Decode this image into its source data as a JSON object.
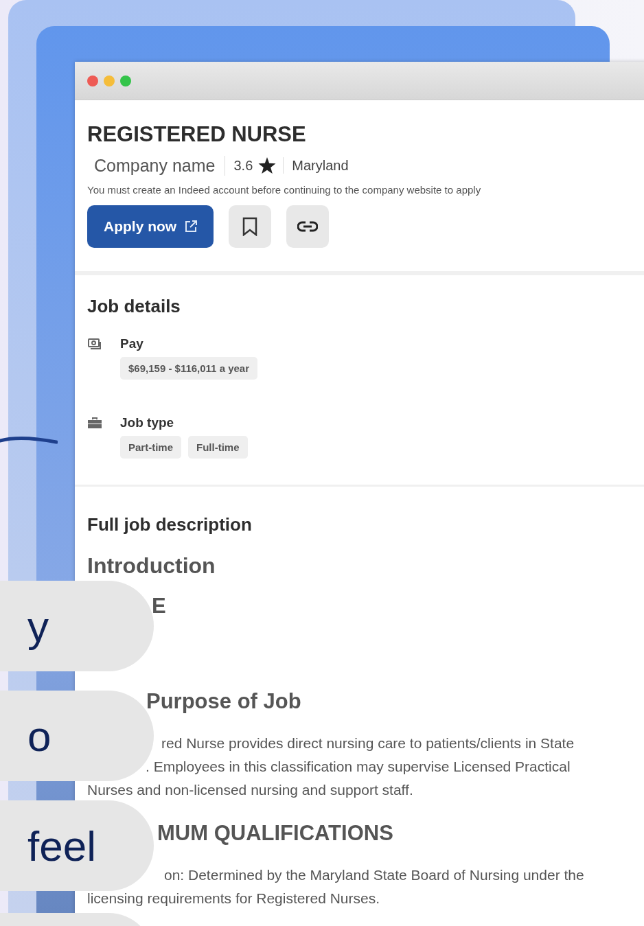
{
  "window": {
    "controls": [
      {
        "color": "#ee5b55"
      },
      {
        "color": "#f5bd3a"
      },
      {
        "color": "#34c44a"
      }
    ]
  },
  "job": {
    "title": "REGISTERED NURSE",
    "company": "Company name",
    "rating": "3.6",
    "location": "Maryland",
    "notice": "You must create an Indeed account before continuing to the company website to apply",
    "apply_button": "Apply now"
  },
  "job_details": {
    "heading": "Job details",
    "items": [
      {
        "kind": "pay",
        "label": "Pay",
        "tags": [
          "$69,159 - $116,011 a year"
        ]
      },
      {
        "kind": "job_type",
        "label": "Job type",
        "tags": [
          "Part-time",
          "Full-time"
        ]
      }
    ]
  },
  "description": {
    "heading": "Full job description",
    "blocks": [
      {
        "kind": "heading",
        "lines": [
          "Introduction"
        ]
      },
      {
        "kind": "subheading",
        "lines": [
          "E"
        ]
      },
      {
        "kind": "subheading",
        "lines": [
          "Purpose of Job"
        ]
      },
      {
        "kind": "paragraph",
        "lines": [
          "red Nurse provides direct nursing care to patients/clients in State",
          ". Employees in this classification may supervise Licensed Practical",
          "Nurses and non-licensed nursing and support staff."
        ]
      },
      {
        "kind": "subheading",
        "lines": [
          "MUM QUALIFICATIONS"
        ]
      },
      {
        "kind": "paragraph",
        "lines": [
          "on: Determined by the Maryland State Board of Nursing under the",
          "licensing requirements for Registered Nurses."
        ]
      }
    ]
  },
  "pills": [
    "y",
    "o",
    "feel"
  ]
}
